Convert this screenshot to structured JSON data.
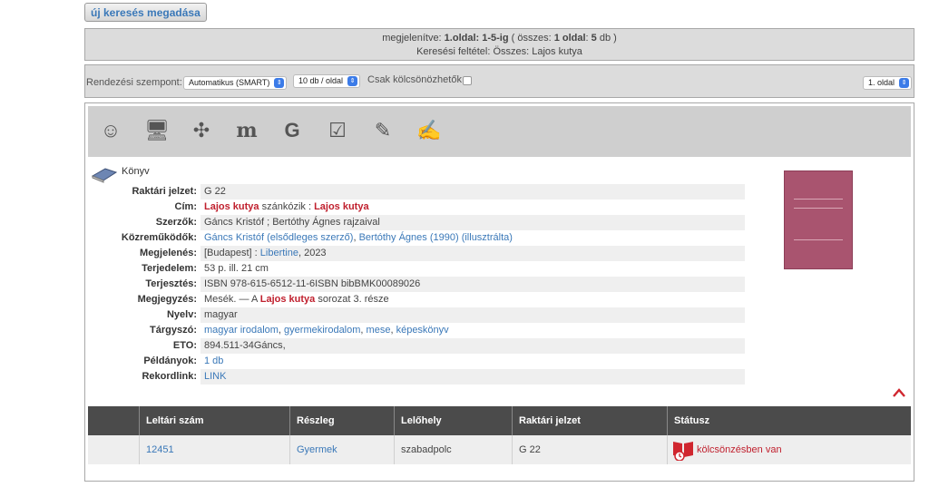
{
  "new_search_label": "új keresés megadása",
  "info": {
    "displayed_prefix": "megjelenítve: ",
    "displayed_range": "1.oldal: 1-5-ig",
    "displayed_mid": " ( összes: ",
    "displayed_page": "1 oldal",
    "displayed_sep": ": ",
    "displayed_count": "5",
    "displayed_suffix": " db )",
    "criteria": "Keresési feltétel: Összes: Lajos kutya"
  },
  "sortbar": {
    "sort_label": "Rendezési szempont:",
    "sort_value": "Automatikus (SMART)",
    "perpage_value": "10 db / oldal",
    "loanable_label": "Csak kölcsönözhetők",
    "page_value": "1. oldal"
  },
  "toolbar_icons": [
    "smiley-icon",
    "monitor-icon",
    "puzzle-icon",
    "m-letter-icon",
    "g-letter-icon",
    "edit-check-icon",
    "book-pen-icon",
    "book-write-icon"
  ],
  "record": {
    "type_label": "Könyv",
    "fields": [
      {
        "label": "Raktári jelzet:",
        "value": "G 22"
      },
      {
        "label": "Cím:",
        "value_hl1": "Lajos kutya",
        "value_mid": " szánkózik : ",
        "value_hl2": "Lajos kutya"
      },
      {
        "label": "Szerzők:",
        "value": "Gáncs Kristóf ; Bertóthy Ágnes rajzaival"
      },
      {
        "label": "Közreműködők:",
        "link1": "Gáncs Kristóf (elsődleges szerző)",
        "sep": ", ",
        "link2": "Bertóthy Ágnes (1990) (illusztrálta)"
      },
      {
        "label": "Megjelenés:",
        "value_pre": "[Budapest] : ",
        "link": "Libertine",
        "value_post": ", 2023"
      },
      {
        "label": "Terjedelem:",
        "value": "53 p. ill. 21 cm"
      },
      {
        "label": "Terjesztés:",
        "value": "ISBN 978-615-6512-11-6ISBN bibBMK00089026"
      },
      {
        "label": "Megjegyzés:",
        "value_pre": "Mesék. — A ",
        "value_hl": "Lajos kutya",
        "value_post": " sorozat 3. része"
      },
      {
        "label": "Nyelv:",
        "value": "magyar"
      },
      {
        "label": "Tárgyszó:",
        "links": [
          "magyar irodalom",
          "gyermekirodalom",
          "mese",
          "képeskönyv"
        ]
      },
      {
        "label": "ETO:",
        "value": "894.511-34Gáncs,"
      },
      {
        "label": "Példányok:",
        "link": "1 db"
      },
      {
        "label": "Rekordlink:",
        "link": "LINK"
      }
    ]
  },
  "copies_table": {
    "headers": [
      "Leltári szám",
      "Részleg",
      "Lelőhely",
      "Raktári jelzet",
      "Státusz"
    ],
    "rows": [
      {
        "inventory": "12451",
        "department": "Gyermek",
        "location": "szabadpolc",
        "shelfmark": "G 22",
        "status": "kölcsönzésben van"
      }
    ]
  },
  "colors": {
    "link": "#3a78b8",
    "highlight": "#c0202e",
    "header_bg": "#4b4b4b"
  }
}
